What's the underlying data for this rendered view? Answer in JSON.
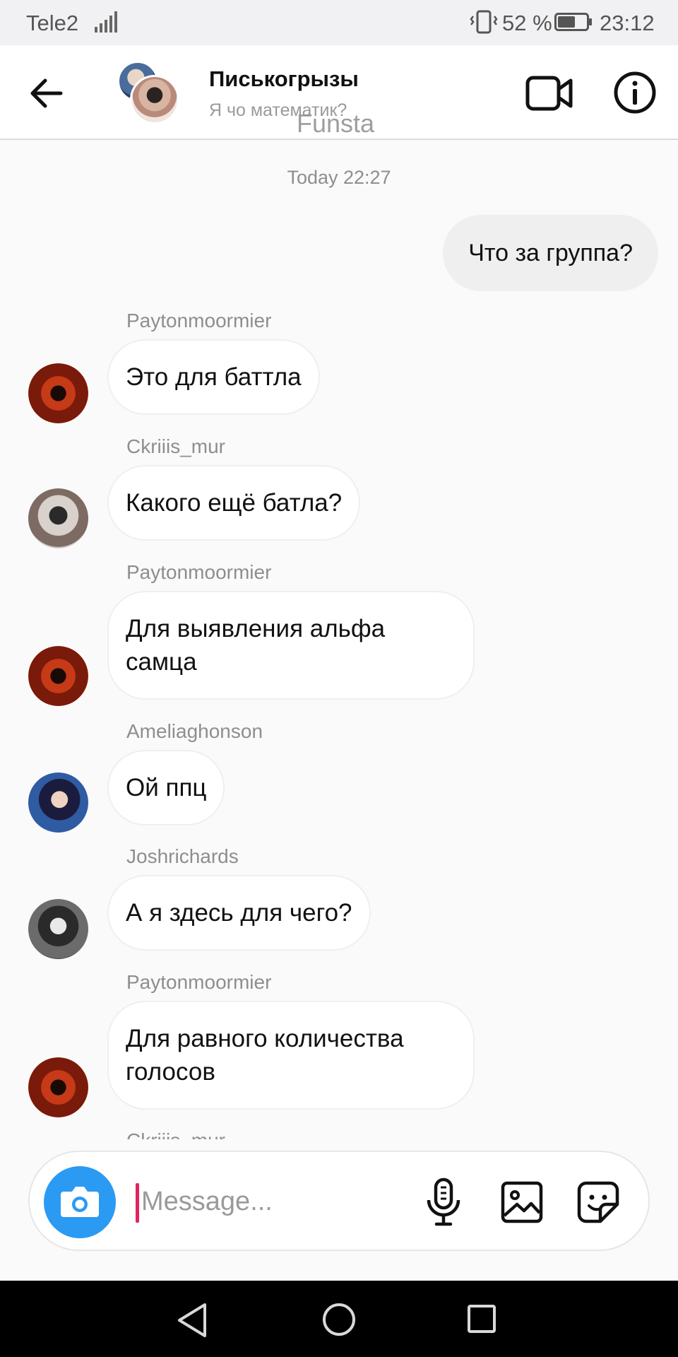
{
  "status_bar": {
    "carrier": "Tele2",
    "battery": "52 %",
    "time": "23:12",
    "icons": [
      "signal-icon",
      "vibrate-icon",
      "battery-icon"
    ]
  },
  "header": {
    "title": "Писькогрызы",
    "subtitle": "Я чо математик?",
    "watermark": "Funsta",
    "icons": [
      "back-arrow-icon",
      "video-call-icon",
      "info-icon"
    ]
  },
  "conversation": {
    "timestamp": "Today 22:27",
    "outgoing": [
      {
        "text": "Что за группа?"
      }
    ],
    "incoming": [
      {
        "sender": "Paytonmoormier",
        "text": "Это для баттла"
      },
      {
        "sender": "Ckriiis_mur",
        "text": "Какого ещё батла?"
      },
      {
        "sender": "Paytonmoormier",
        "text": "Для выявления альфа самца"
      },
      {
        "sender": "Ameliaghonson",
        "text": "Ой ппц"
      },
      {
        "sender": "Joshrichards",
        "text": "А я здесь для чего?"
      },
      {
        "sender": "Paytonmoormier",
        "text": "Для равного количества голосов"
      }
    ],
    "cut_off_sender": "Ckriiis_mur"
  },
  "composer": {
    "placeholder": "Message...",
    "icons": [
      "camera-icon",
      "microphone-icon",
      "gallery-icon",
      "sticker-icon"
    ],
    "accent_color": "#2b9af3"
  },
  "nav_bar": {
    "icons": [
      "nav-back-icon",
      "nav-home-icon",
      "nav-recent-apps-icon"
    ]
  }
}
